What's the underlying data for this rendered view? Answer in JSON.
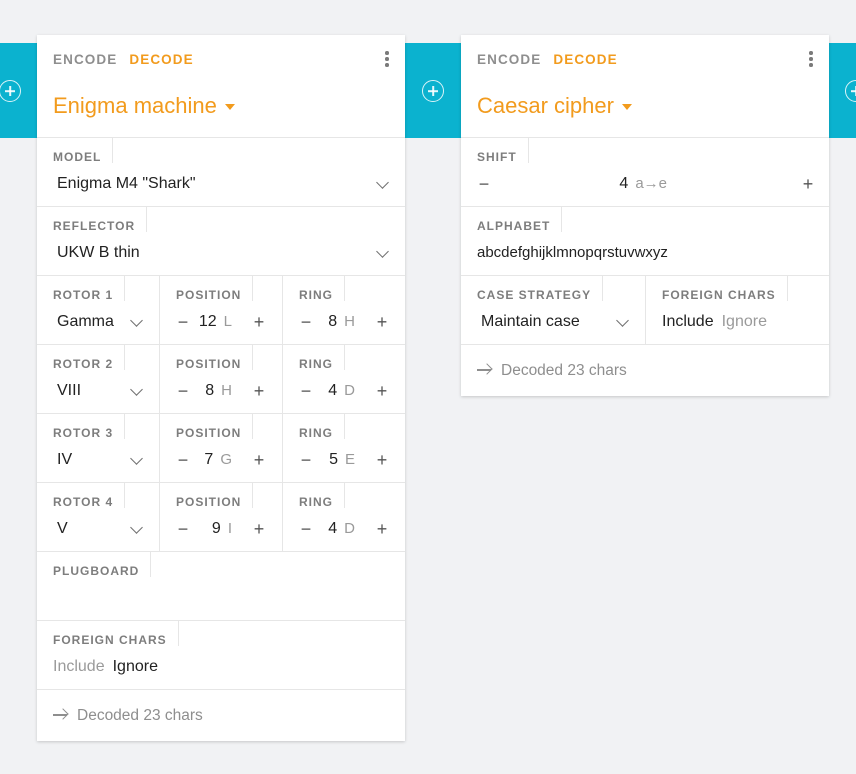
{
  "enigma": {
    "tabs": [
      "ENCODE",
      "DECODE"
    ],
    "title": "Enigma machine",
    "model_label": "MODEL",
    "model_value": "Enigma M4 \"Shark\"",
    "reflector_label": "REFLECTOR",
    "reflector_value": "UKW B thin",
    "rotors": [
      {
        "label": "ROTOR 1",
        "value": "Gamma",
        "pos_label": "POSITION",
        "pos_num": "12",
        "pos_letter": "L",
        "ring_label": "RING",
        "ring_num": "8",
        "ring_letter": "H"
      },
      {
        "label": "ROTOR 2",
        "value": "VIII",
        "pos_label": "POSITION",
        "pos_num": "8",
        "pos_letter": "H",
        "ring_label": "RING",
        "ring_num": "4",
        "ring_letter": "D"
      },
      {
        "label": "ROTOR 3",
        "value": "IV",
        "pos_label": "POSITION",
        "pos_num": "7",
        "pos_letter": "G",
        "ring_label": "RING",
        "ring_num": "5",
        "ring_letter": "E"
      },
      {
        "label": "ROTOR 4",
        "value": "V",
        "pos_label": "POSITION",
        "pos_num": "9",
        "pos_letter": "I",
        "ring_label": "RING",
        "ring_num": "4",
        "ring_letter": "D"
      }
    ],
    "plugboard_label": "PLUGBOARD",
    "plugboard_value": "",
    "foreign_label": "FOREIGN CHARS",
    "foreign_include": "Include",
    "foreign_ignore": "Ignore",
    "footer": "Decoded 23 chars"
  },
  "caesar": {
    "tabs": [
      "ENCODE",
      "DECODE"
    ],
    "title": "Caesar cipher",
    "shift_label": "SHIFT",
    "shift_num": "4",
    "shift_map": "a→e",
    "alphabet_label": "ALPHABET",
    "alphabet_value": "abcdefghijklmnopqrstuvwxyz",
    "case_label": "CASE STRATEGY",
    "case_value": "Maintain case",
    "foreign_label": "FOREIGN CHARS",
    "foreign_include": "Include",
    "foreign_ignore": "Ignore",
    "footer": "Decoded 23 chars"
  },
  "colors": {
    "accent": "#f29b1d",
    "teal": "#0bb2cf"
  }
}
